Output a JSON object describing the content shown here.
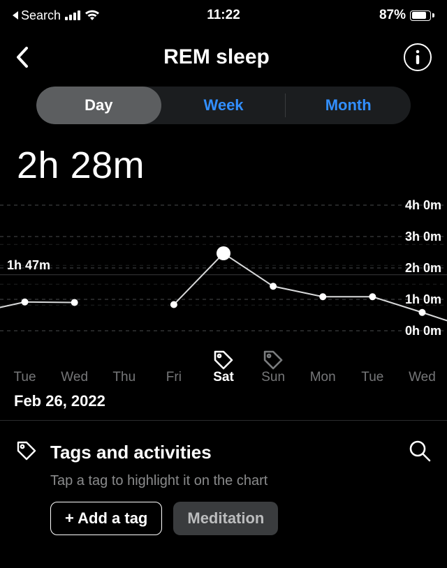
{
  "status": {
    "back_app": "Search",
    "time": "11:22",
    "battery_pct": "87%",
    "battery_fill_pct": 87
  },
  "nav": {
    "title": "REM sleep"
  },
  "segmented": {
    "items": [
      "Day",
      "Week",
      "Month"
    ],
    "active_index": 0
  },
  "summary_value": "2h 28m",
  "selected_date": "Feb 26, 2022",
  "chart_data": {
    "type": "line",
    "x_categories": [
      "Tue",
      "Wed",
      "Thu",
      "Fri",
      "Sat",
      "Sun",
      "Mon",
      "Tue",
      "Wed"
    ],
    "y_ticks_minutes": [
      0,
      60,
      120,
      180,
      240
    ],
    "y_tick_labels": [
      "0h 0m",
      "1h 0m",
      "2h 0m",
      "3h 0m",
      "4h 0m"
    ],
    "ylim_minutes": [
      0,
      240
    ],
    "left_marker": {
      "label": "1h 47m",
      "minutes": 107
    },
    "highlight_index": 4,
    "tagged_indices": [
      4,
      5
    ],
    "series": [
      {
        "name": "REM sleep (minutes)",
        "values_minutes": [
          55,
          54,
          null,
          50,
          148,
          85,
          65,
          65,
          35
        ]
      }
    ],
    "notes": "values are minutes of REM sleep per day, estimated from chart; null = no visible data point"
  },
  "tags": {
    "section_title": "Tags and activities",
    "subtitle": "Tap a tag to highlight it on the chart",
    "add_label": "+ Add a tag",
    "chips": [
      "Meditation"
    ]
  }
}
